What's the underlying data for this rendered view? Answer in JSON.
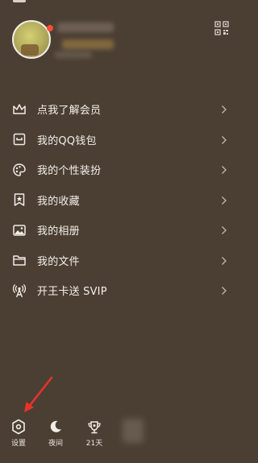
{
  "menu": {
    "items": [
      {
        "label": "点我了解会员",
        "icon": "crown-icon"
      },
      {
        "label": "我的QQ钱包",
        "icon": "wallet-icon"
      },
      {
        "label": "我的个性装扮",
        "icon": "palette-icon"
      },
      {
        "label": "我的收藏",
        "icon": "bookmark-star-icon"
      },
      {
        "label": "我的相册",
        "icon": "photo-icon"
      },
      {
        "label": "我的文件",
        "icon": "folder-icon"
      },
      {
        "label": "开王卡送 SVIP",
        "icon": "signal-tower-icon"
      }
    ]
  },
  "bottom": {
    "settings_label": "设置",
    "night_label": "夜间",
    "weather_label": "21天"
  },
  "colors": {
    "background": "#4b3f34",
    "text": "#f4f0ea",
    "notification_dot": "#ff4d35",
    "annotation_arrow": "#e8322a"
  }
}
